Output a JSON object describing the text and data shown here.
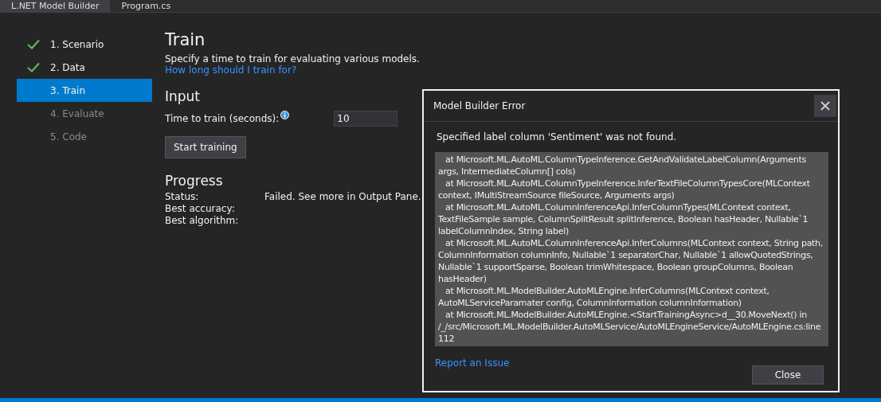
{
  "tabs": [
    {
      "label": "L.NET Model Builder",
      "selected": true
    },
    {
      "label": "Program.cs",
      "selected": false
    }
  ],
  "steps": [
    {
      "label": "1. Scenario",
      "done": true,
      "selected": false,
      "disabled": false
    },
    {
      "label": "2. Data",
      "done": true,
      "selected": false,
      "disabled": false
    },
    {
      "label": "3. Train",
      "done": false,
      "selected": true,
      "disabled": false
    },
    {
      "label": "4. Evaluate",
      "done": false,
      "selected": false,
      "disabled": true
    },
    {
      "label": "5. Code",
      "done": false,
      "selected": false,
      "disabled": true
    }
  ],
  "page": {
    "title": "Train",
    "description": "Specify a time to train for evaluating various models.",
    "help_link": "How long should I train for?"
  },
  "input": {
    "heading": "Input",
    "label": "Time to train (seconds):",
    "value": "10",
    "button": "Start training"
  },
  "progress": {
    "heading": "Progress",
    "rows": [
      {
        "label": "Status:",
        "value": "Failed. See more in Output Pane."
      },
      {
        "label": "Best accuracy:"
      },
      {
        "label": "Best algorithm:"
      }
    ]
  },
  "dialog": {
    "title": "Model Builder Error",
    "message": "Specified label column 'Sentiment' was not found.",
    "trace": [
      "at Microsoft.ML.AutoML.ColumnTypeInference.GetAndValidateLabelColumn(Arguments args, IntermediateColumn[] cols)",
      "at Microsoft.ML.AutoML.ColumnTypeInference.InferTextFileColumnTypesCore(MLContext context, IMultiStreamSource fileSource, Arguments args)",
      "at Microsoft.ML.AutoML.ColumnInferenceApi.InferColumnTypes(MLContext context, TextFileSample sample, ColumnSplitResult splitInference, Boolean hasHeader, Nullable`1 labelColumnIndex, String label)",
      "at Microsoft.ML.AutoML.ColumnInferenceApi.InferColumns(MLContext context, String path, ColumnInformation columnInfo, Nullable`1 separatorChar, Nullable`1 allowQuotedStrings, Nullable`1 supportSparse, Boolean trimWhitespace, Boolean groupColumns, Boolean hasHeader)",
      "at Microsoft.ML.ModelBuilder.AutoMLEngine.InferColumns(MLContext context, AutoMLServiceParamater config, ColumnInformation columnInformation)",
      "at Microsoft.ML.ModelBuilder.AutoMLEngine.<StartTrainingAsync>d__30.MoveNext() in /_/src/Microsoft.ML.ModelBuilder.AutoMLService/AutoMLEngineService/AutoMLEngine.cs:line 112"
    ],
    "link": "Report an Issue",
    "button": "Close"
  }
}
